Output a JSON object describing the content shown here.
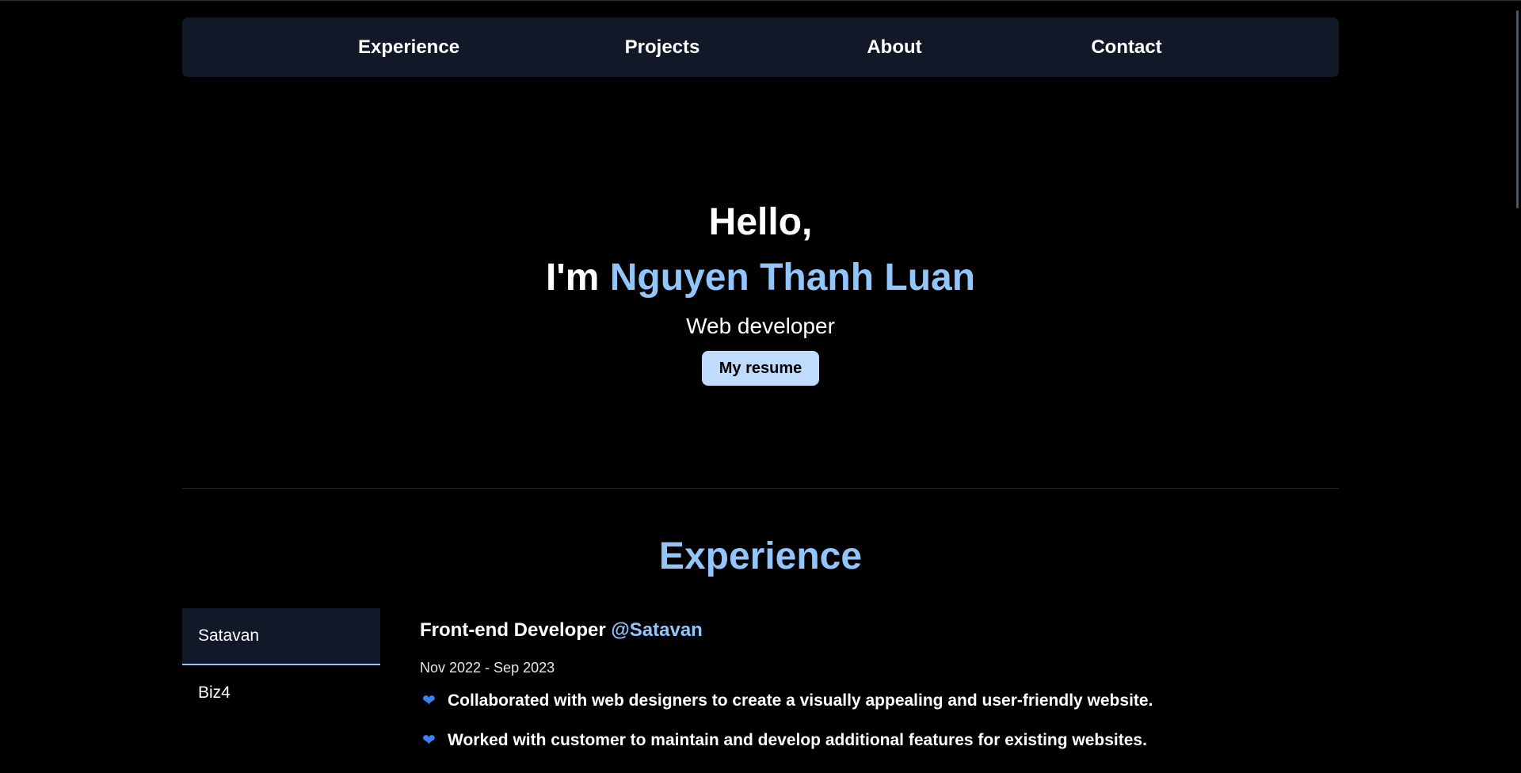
{
  "nav": {
    "items": [
      {
        "label": "Experience"
      },
      {
        "label": "Projects"
      },
      {
        "label": "About"
      },
      {
        "label": "Contact"
      }
    ]
  },
  "hero": {
    "greeting": "Hello,",
    "intro_prefix": "I'm",
    "name": "Nguyen Thanh Luan",
    "role": "Web developer",
    "resume_label": "My resume"
  },
  "experience": {
    "title": "Experience",
    "tabs": [
      {
        "label": "Satavan",
        "active": true
      },
      {
        "label": "Biz4",
        "active": false
      }
    ],
    "job": {
      "position": "Front-end Developer",
      "company": "@Satavan",
      "dates": "Nov 2022 - Sep 2023",
      "bullets": [
        "Collaborated with web designers to create a visually appealing and user-friendly website.",
        "Worked with customer to maintain and develop additional features for existing websites."
      ]
    }
  },
  "colors": {
    "background": "#000000",
    "panel": "#111827",
    "accent": "#93c5fd",
    "button": "#bfdbfe",
    "heart": "#3b82f6"
  },
  "icons": {
    "bullet": "blue-heart-icon"
  }
}
